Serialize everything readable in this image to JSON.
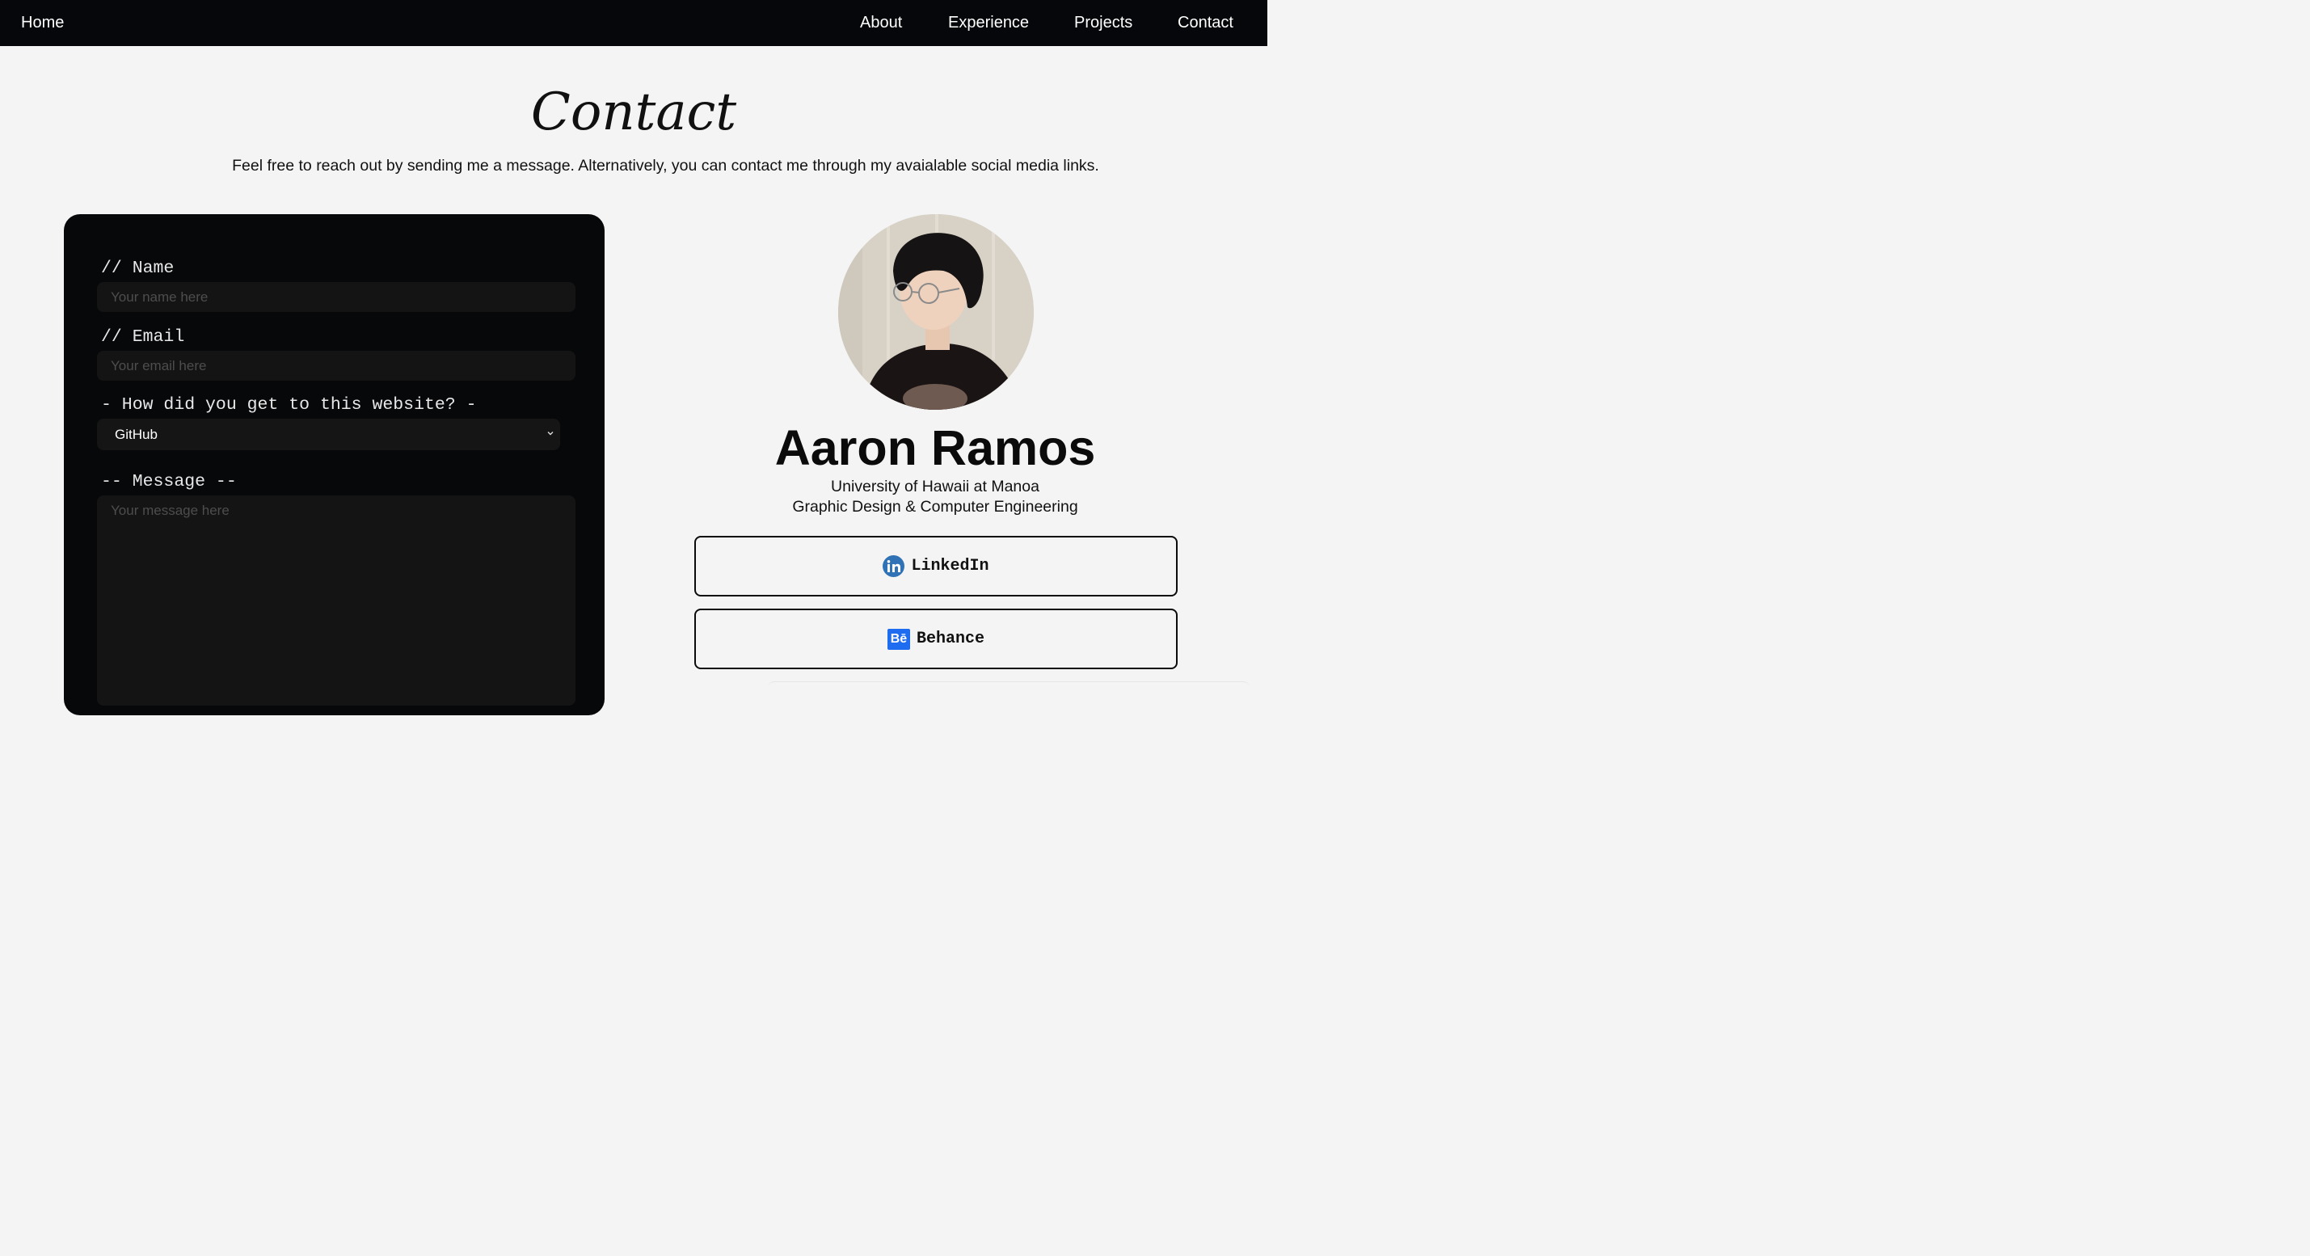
{
  "nav": {
    "home": "Home",
    "links": [
      "About",
      "Experience",
      "Projects",
      "Contact"
    ]
  },
  "page": {
    "title": "Contact",
    "subtitle": "Feel free to reach out by sending me a message. Alternatively, you can contact me through my avaialable social media links."
  },
  "form": {
    "name_label": "// Name",
    "name_placeholder": "Your name here",
    "email_label": "// Email",
    "email_placeholder": "Your email here",
    "source_label": "- How did you get to this website? -",
    "source_selected": "GitHub",
    "message_label": "-- Message --",
    "message_placeholder": "Your message here"
  },
  "profile": {
    "name": "Aaron Ramos",
    "school": "University of Hawaii at Manoa",
    "major": "Graphic Design & Computer Engineering"
  },
  "socials": [
    {
      "label": "LinkedIn",
      "icon": "linkedin-icon",
      "icon_text": "in",
      "color": "#2f72b5"
    },
    {
      "label": "Behance",
      "icon": "behance-icon",
      "icon_text": "Bē",
      "color": "#1e6cf0"
    }
  ],
  "colors": {
    "nav_bg": "#06070a",
    "page_bg": "#f4f4f4",
    "card_bg": "#07080a",
    "field_bg": "#141414"
  }
}
